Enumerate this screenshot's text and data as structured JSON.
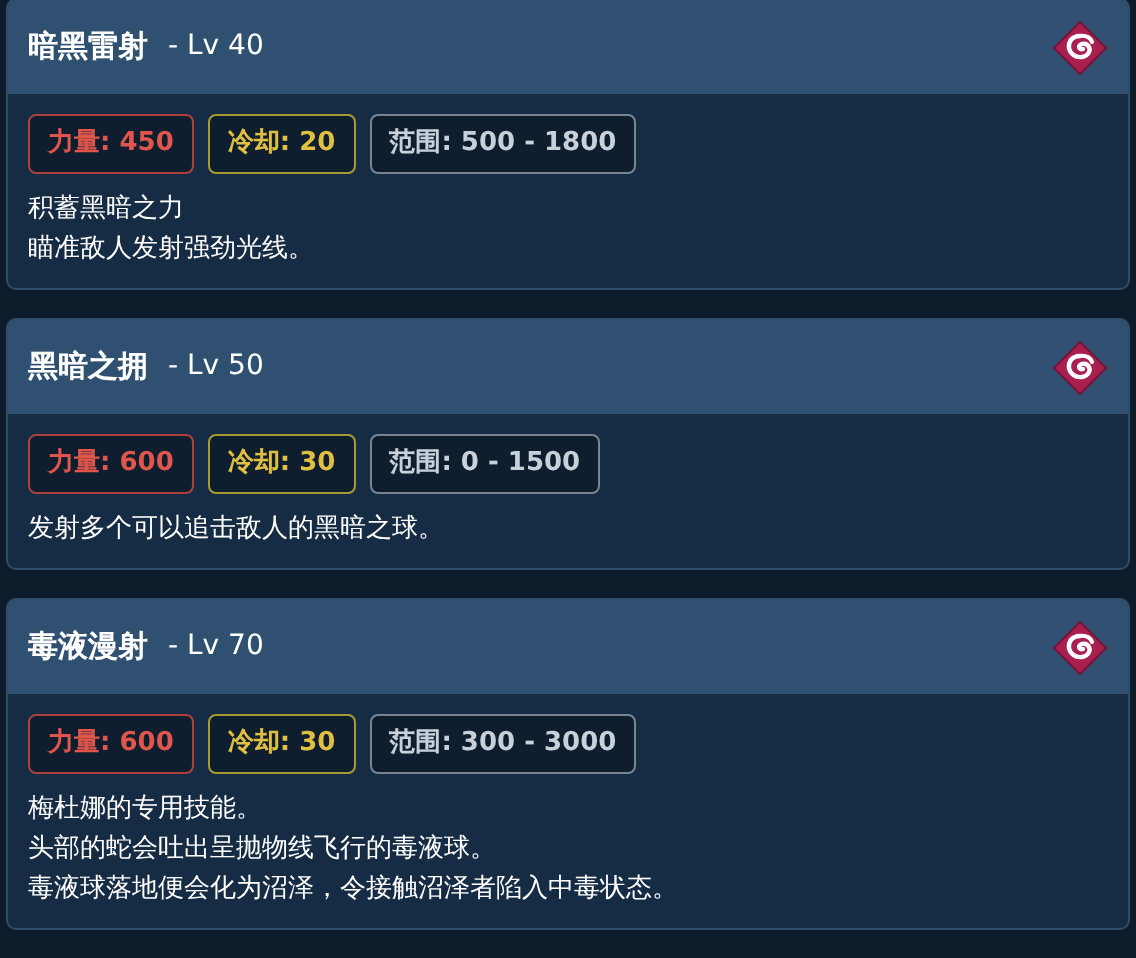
{
  "skills": [
    {
      "name": "暗黑雷射",
      "level": "- Lv 40",
      "stats": [
        {
          "kind": "power",
          "text": "力量: 450"
        },
        {
          "kind": "cooldown",
          "text": "冷却: 20"
        },
        {
          "kind": "range",
          "text": "范围: 500 - 1800"
        }
      ],
      "description": [
        "积蓄黑暗之力",
        "瞄准敌人发射强劲光线。"
      ]
    },
    {
      "name": "黑暗之拥",
      "level": "- Lv 50",
      "stats": [
        {
          "kind": "power",
          "text": "力量: 600"
        },
        {
          "kind": "cooldown",
          "text": "冷却: 30"
        },
        {
          "kind": "range",
          "text": "范围: 0 - 1500"
        }
      ],
      "description": [
        "发射多个可以追击敌人的黑暗之球。"
      ]
    },
    {
      "name": "毒液漫射",
      "level": "- Lv 70",
      "stats": [
        {
          "kind": "power",
          "text": "力量: 600"
        },
        {
          "kind": "cooldown",
          "text": "冷却: 30"
        },
        {
          "kind": "range",
          "text": "范围: 300 - 3000"
        }
      ],
      "description": [
        "梅杜娜的专用技能。",
        "头部的蛇会吐出呈抛物线飞行的毒液球。",
        "毒液球落地便会化为沼泽，令接触沼泽者陷入中毒状态。"
      ]
    }
  ]
}
